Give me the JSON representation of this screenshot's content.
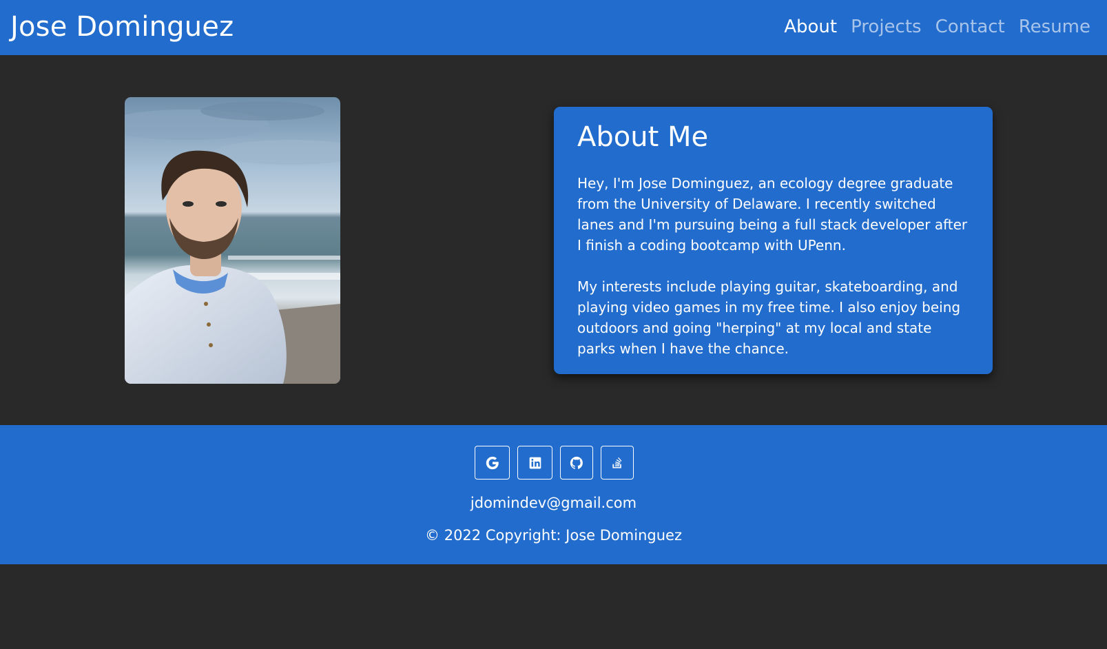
{
  "header": {
    "brand": "Jose Dominguez",
    "nav": [
      {
        "label": "About",
        "active": true
      },
      {
        "label": "Projects",
        "active": false
      },
      {
        "label": "Contact",
        "active": false
      },
      {
        "label": "Resume",
        "active": false
      }
    ]
  },
  "about": {
    "title": "About Me",
    "paragraphs": [
      "Hey, I'm Jose Dominguez, an ecology degree graduate from the University of Delaware. I recently switched lanes and I'm pursuing being a full stack developer after I finish a coding bootcamp with UPenn.",
      "My interests include playing guitar, skateboarding, and playing video games in my free time. I also enjoy being outdoors and going \"herping\" at my local and state parks when I have the chance."
    ]
  },
  "footer": {
    "social": [
      {
        "icon": "google-icon"
      },
      {
        "icon": "linkedin-icon"
      },
      {
        "icon": "github-icon"
      },
      {
        "icon": "stack-overflow-icon"
      }
    ],
    "email": "jdomindev@gmail.com",
    "copyright": "© 2022 Copyright: Jose Dominguez"
  },
  "colors": {
    "primary": "#216ccc",
    "background": "#292929",
    "nav_inactive": "#a9c4ea",
    "text": "#ffffff"
  }
}
